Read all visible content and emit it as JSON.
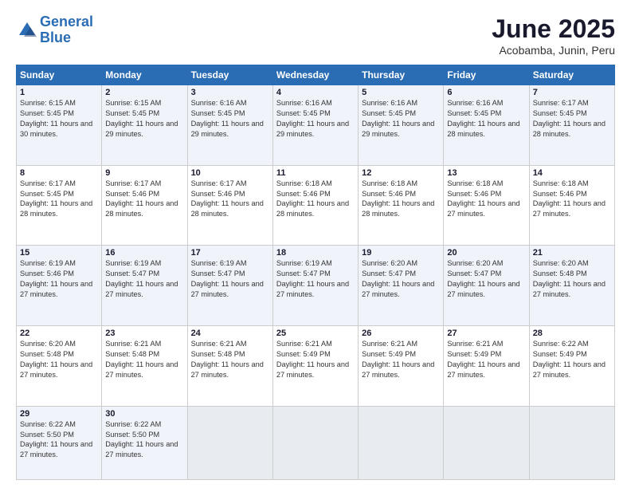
{
  "header": {
    "logo_line1": "General",
    "logo_line2": "Blue",
    "title": "June 2025",
    "subtitle": "Acobamba, Junin, Peru"
  },
  "weekdays": [
    "Sunday",
    "Monday",
    "Tuesday",
    "Wednesday",
    "Thursday",
    "Friday",
    "Saturday"
  ],
  "weeks": [
    [
      {
        "day": "1",
        "rise": "6:15 AM",
        "set": "5:45 PM",
        "hours": "11 hours and 30 minutes."
      },
      {
        "day": "2",
        "rise": "6:15 AM",
        "set": "5:45 PM",
        "hours": "11 hours and 29 minutes."
      },
      {
        "day": "3",
        "rise": "6:16 AM",
        "set": "5:45 PM",
        "hours": "11 hours and 29 minutes."
      },
      {
        "day": "4",
        "rise": "6:16 AM",
        "set": "5:45 PM",
        "hours": "11 hours and 29 minutes."
      },
      {
        "day": "5",
        "rise": "6:16 AM",
        "set": "5:45 PM",
        "hours": "11 hours and 29 minutes."
      },
      {
        "day": "6",
        "rise": "6:16 AM",
        "set": "5:45 PM",
        "hours": "11 hours and 28 minutes."
      },
      {
        "day": "7",
        "rise": "6:17 AM",
        "set": "5:45 PM",
        "hours": "11 hours and 28 minutes."
      }
    ],
    [
      {
        "day": "8",
        "rise": "6:17 AM",
        "set": "5:45 PM",
        "hours": "11 hours and 28 minutes."
      },
      {
        "day": "9",
        "rise": "6:17 AM",
        "set": "5:46 PM",
        "hours": "11 hours and 28 minutes."
      },
      {
        "day": "10",
        "rise": "6:17 AM",
        "set": "5:46 PM",
        "hours": "11 hours and 28 minutes."
      },
      {
        "day": "11",
        "rise": "6:18 AM",
        "set": "5:46 PM",
        "hours": "11 hours and 28 minutes."
      },
      {
        "day": "12",
        "rise": "6:18 AM",
        "set": "5:46 PM",
        "hours": "11 hours and 28 minutes."
      },
      {
        "day": "13",
        "rise": "6:18 AM",
        "set": "5:46 PM",
        "hours": "11 hours and 27 minutes."
      },
      {
        "day": "14",
        "rise": "6:18 AM",
        "set": "5:46 PM",
        "hours": "11 hours and 27 minutes."
      }
    ],
    [
      {
        "day": "15",
        "rise": "6:19 AM",
        "set": "5:46 PM",
        "hours": "11 hours and 27 minutes."
      },
      {
        "day": "16",
        "rise": "6:19 AM",
        "set": "5:47 PM",
        "hours": "11 hours and 27 minutes."
      },
      {
        "day": "17",
        "rise": "6:19 AM",
        "set": "5:47 PM",
        "hours": "11 hours and 27 minutes."
      },
      {
        "day": "18",
        "rise": "6:19 AM",
        "set": "5:47 PM",
        "hours": "11 hours and 27 minutes."
      },
      {
        "day": "19",
        "rise": "6:20 AM",
        "set": "5:47 PM",
        "hours": "11 hours and 27 minutes."
      },
      {
        "day": "20",
        "rise": "6:20 AM",
        "set": "5:47 PM",
        "hours": "11 hours and 27 minutes."
      },
      {
        "day": "21",
        "rise": "6:20 AM",
        "set": "5:48 PM",
        "hours": "11 hours and 27 minutes."
      }
    ],
    [
      {
        "day": "22",
        "rise": "6:20 AM",
        "set": "5:48 PM",
        "hours": "11 hours and 27 minutes."
      },
      {
        "day": "23",
        "rise": "6:21 AM",
        "set": "5:48 PM",
        "hours": "11 hours and 27 minutes."
      },
      {
        "day": "24",
        "rise": "6:21 AM",
        "set": "5:48 PM",
        "hours": "11 hours and 27 minutes."
      },
      {
        "day": "25",
        "rise": "6:21 AM",
        "set": "5:49 PM",
        "hours": "11 hours and 27 minutes."
      },
      {
        "day": "26",
        "rise": "6:21 AM",
        "set": "5:49 PM",
        "hours": "11 hours and 27 minutes."
      },
      {
        "day": "27",
        "rise": "6:21 AM",
        "set": "5:49 PM",
        "hours": "11 hours and 27 minutes."
      },
      {
        "day": "28",
        "rise": "6:22 AM",
        "set": "5:49 PM",
        "hours": "11 hours and 27 minutes."
      }
    ],
    [
      {
        "day": "29",
        "rise": "6:22 AM",
        "set": "5:50 PM",
        "hours": "11 hours and 27 minutes."
      },
      {
        "day": "30",
        "rise": "6:22 AM",
        "set": "5:50 PM",
        "hours": "11 hours and 27 minutes."
      },
      null,
      null,
      null,
      null,
      null
    ]
  ]
}
